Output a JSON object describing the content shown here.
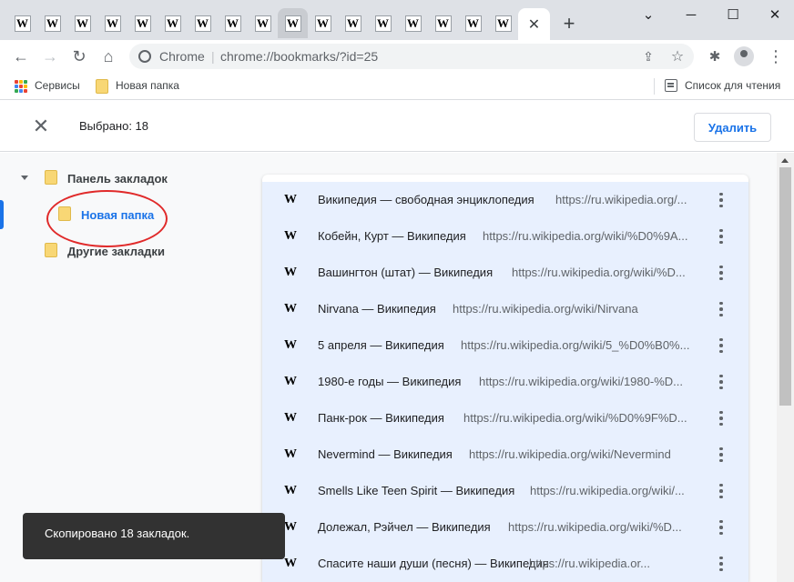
{
  "tabs": {
    "count": 17,
    "favicon_text": "W",
    "close_label": "✕",
    "new_tab_label": "+"
  },
  "window": {
    "minimize": "─",
    "maximize": "☐",
    "close": "✕",
    "dropdown": "⌄"
  },
  "toolbar": {
    "back": "←",
    "forward": "→",
    "reload": "↻",
    "home": "⌂",
    "site_label": "Chrome",
    "separator": "|",
    "url": "chrome://bookmarks/?id=25",
    "share_icon": "⇪",
    "star_icon": "☆",
    "extensions_icon": "✱",
    "menu_icon": "⋮"
  },
  "bookmarks_bar": {
    "apps_label": "Сервисы",
    "folder_label": "Новая папка",
    "reading_list_label": "Список для чтения",
    "apps_colors": [
      "#ea4335",
      "#fbbc04",
      "#34a853",
      "#4285f4",
      "#ea4335",
      "#fbbc04",
      "#34a853",
      "#4285f4",
      "#ea4335"
    ]
  },
  "selection": {
    "close_label": "✕",
    "count_text": "Выбрано: 18",
    "delete_label": "Удалить"
  },
  "tree": {
    "bookmarks_bar": "Панель закладок",
    "new_folder": "Новая папка",
    "other_bookmarks": "Другие закладки"
  },
  "bookmarks": [
    {
      "title": "Википедия — свободная энциклопедия",
      "url": "https://ru.wikipedia.org/..."
    },
    {
      "title": "Кобейн, Курт — Википедия",
      "url": "https://ru.wikipedia.org/wiki/%D0%9A..."
    },
    {
      "title": "Вашингтон (штат) — Википедия",
      "url": "https://ru.wikipedia.org/wiki/%D..."
    },
    {
      "title": "Nirvana — Википедия",
      "url": "https://ru.wikipedia.org/wiki/Nirvana"
    },
    {
      "title": "5 апреля — Википедия",
      "url": "https://ru.wikipedia.org/wiki/5_%D0%B0%..."
    },
    {
      "title": "1980-е годы — Википедия",
      "url": "https://ru.wikipedia.org/wiki/1980-%D..."
    },
    {
      "title": "Панк-рок — Википедия",
      "url": "https://ru.wikipedia.org/wiki/%D0%9F%D..."
    },
    {
      "title": "Nevermind — Википедия",
      "url": "https://ru.wikipedia.org/wiki/Nevermind"
    },
    {
      "title": "Smells Like Teen Spirit — Википедия",
      "url": "https://ru.wikipedia.org/wiki/..."
    },
    {
      "title": "Долежал, Рэйчел — Википедия",
      "url": "https://ru.wikipedia.org/wiki/%D..."
    },
    {
      "title": "Спасите наши души (песня) — Википедия",
      "url": "https://ru.wikipedia.or..."
    }
  ],
  "toast": {
    "message": "Скопировано 18 закладок."
  }
}
